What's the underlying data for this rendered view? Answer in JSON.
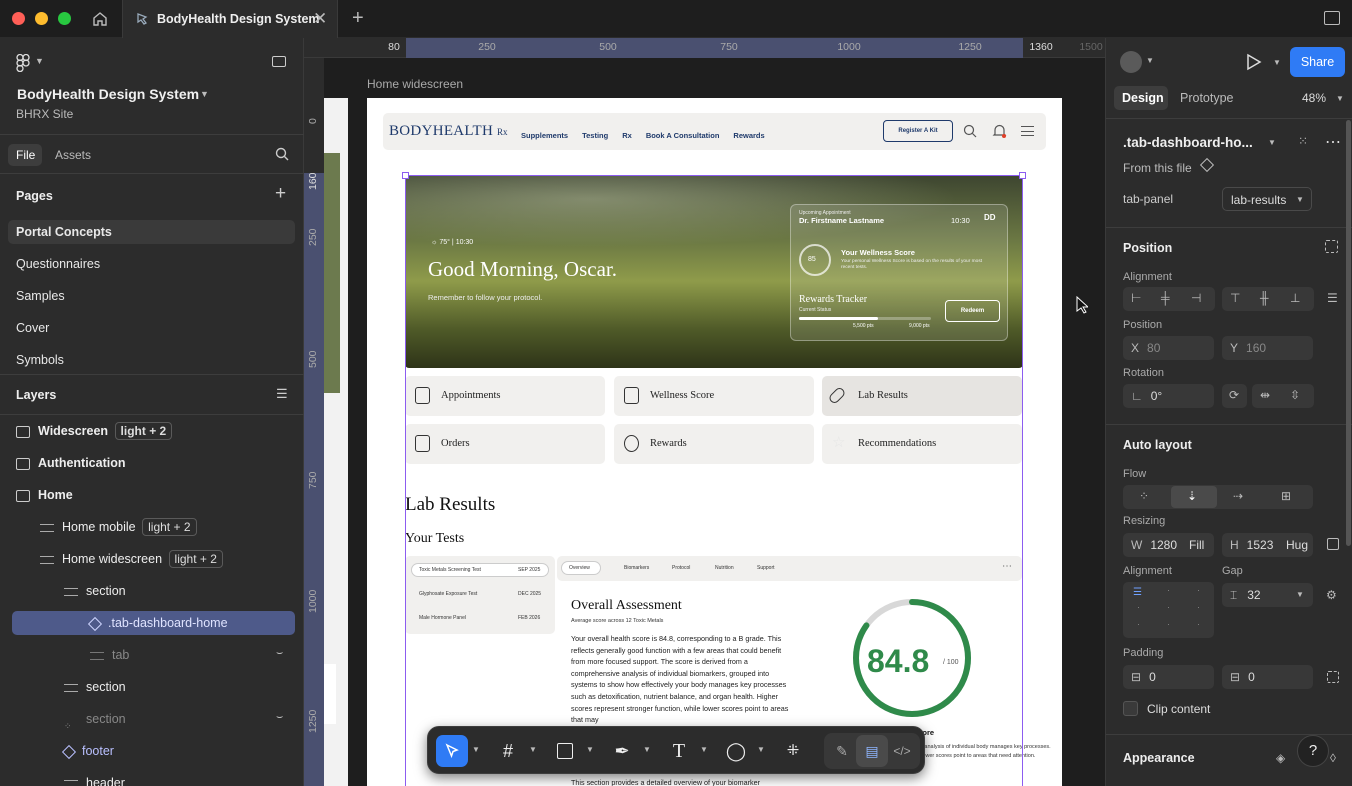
{
  "window": {
    "tab_title": "BodyHealth Design System"
  },
  "left_panel": {
    "project_name": "BodyHealth Design System",
    "team": "BHRX Site",
    "tabs": [
      "File",
      "Assets"
    ],
    "pages_header": "Pages",
    "pages": [
      "Portal Concepts",
      "Questionnaires",
      "Samples",
      "Cover",
      "Symbols"
    ],
    "layers_header": "Layers",
    "layers": [
      {
        "name": "Widescreen",
        "badge": "light + 2"
      },
      {
        "name": "Authentication",
        "badge": ""
      },
      {
        "name": "Home",
        "badge": ""
      },
      {
        "name": "Home mobile",
        "badge": "light + 2"
      },
      {
        "name": "Home widescreen",
        "badge": "light + 2"
      },
      {
        "name": "section",
        "badge": ""
      },
      {
        "name": ".tab-dashboard-home",
        "badge": ""
      },
      {
        "name": "tab",
        "badge": ""
      },
      {
        "name": "section",
        "badge": ""
      },
      {
        "name": "section",
        "badge": ""
      },
      {
        "name": "footer",
        "badge": ""
      },
      {
        "name": "header",
        "badge": ""
      }
    ]
  },
  "canvas": {
    "ruler_top": [
      "80",
      "250",
      "500",
      "750",
      "1000",
      "1250",
      "1360",
      "1500"
    ],
    "ruler_left": [
      "0",
      "160",
      "250",
      "500",
      "750",
      "1000",
      "1250"
    ],
    "frame_label": "Home widescreen",
    "site": {
      "logo": "BODYHEALTH",
      "logo_rx": "Rx",
      "nav": [
        "Supplements",
        "Testing",
        "Rx",
        "Book A Consultation",
        "Rewards"
      ],
      "cta": "Register A Kit",
      "weather": "75°",
      "time": "10:30",
      "greeting": "Good Morning, Oscar.",
      "subgreeting": "Remember to follow your protocol.",
      "appt_label": "Upcoming Appointment",
      "appt_name": "Dr. Firstname Lastname",
      "appt_time": "10:30",
      "appt_date": "DD",
      "wellness_title": "Your Wellness Score",
      "wellness_desc": "Your personal Wellness Score is based on the results of your most recent tests.",
      "wellness_num": "85",
      "rewards_title": "Rewards Tracker",
      "rewards_status": "Current Status",
      "rewards_pts": "5,500 pts",
      "rewards_max": "9,000 pts",
      "redeem": "Redeem",
      "cards": [
        "Appointments",
        "Wellness Score",
        "Lab Results",
        "Orders",
        "Rewards",
        "Recommendations"
      ],
      "section_title": "Lab Results",
      "tests_title": "Your Tests",
      "tests": [
        {
          "name": "Toxic Metals Screening Test",
          "date": "SEP 2025"
        },
        {
          "name": "Glyphosate Exposure Test",
          "date": "DEC 2025"
        },
        {
          "name": "Male Hormone Panel",
          "date": "FEB 2026"
        }
      ],
      "result_tabs": [
        "Overview",
        "Biomarkers",
        "Protocol",
        "Nutrition",
        "Support"
      ],
      "assessment_title": "Overall Assessment",
      "assessment_sub": "Average score across 12 Toxic Metals",
      "assessment_body": "Your overall health score is 84.8, corresponding to a B grade. This reflects generally good function with a few areas that could benefit from more focused support. The score is derived from a comprehensive analysis of individual biomarkers, grouped into systems to show how effectively your body manages key processes such as detoxification, nutrient balance, and organ health. Higher scores represent stronger function, while lower scores point to areas that may",
      "assessment_more": "This section provides a detailed overview of your biomarker",
      "score": "84.8",
      "score_max": "/ 100",
      "score_label": "s Score",
      "score_desc": "ensive analysis of individual body manages key processes. while lower scores point to areas that need attention.",
      "score_value": 0.848
    }
  },
  "right_panel": {
    "tabs": [
      "Design",
      "Prototype"
    ],
    "zoom": "48%",
    "share": "Share",
    "component": ".tab-dashboard-ho...",
    "from_file": "From this file",
    "prop_name": "tab-panel",
    "prop_value": "lab-results",
    "position_header": "Position",
    "alignment_label": "Alignment",
    "position_label": "Position",
    "x_label": "X",
    "x_value": "80",
    "y_label": "Y",
    "y_value": "160",
    "rotation_label": "Rotation",
    "rotation_value": "0°",
    "auto_layout_header": "Auto layout",
    "flow_label": "Flow",
    "resizing_label": "Resizing",
    "w_label": "W",
    "w_value": "1280",
    "w_mode": "Fill",
    "h_label": "H",
    "h_value": "1523",
    "h_mode": "Hug",
    "al_alignment_label": "Alignment",
    "gap_label": "Gap",
    "gap_value": "32",
    "padding_label": "Padding",
    "pad_h": "0",
    "pad_v": "0",
    "clip_label": "Clip content",
    "appearance_header": "Appearance"
  }
}
